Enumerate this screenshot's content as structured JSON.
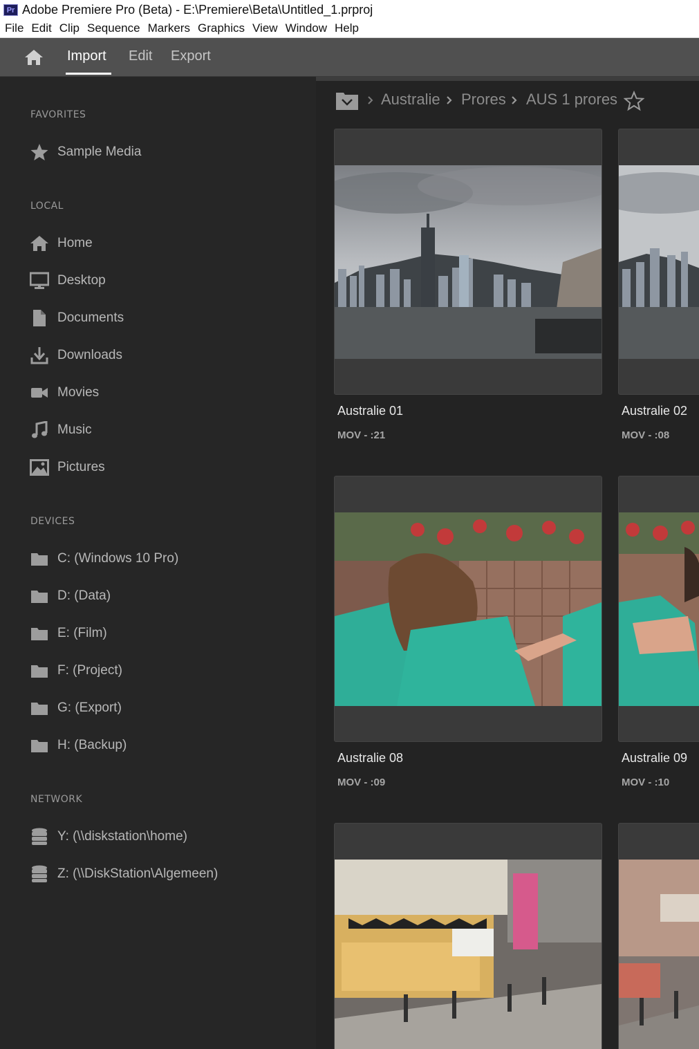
{
  "window": {
    "title": "Adobe Premiere Pro (Beta) - E:\\Premiere\\Beta\\Untitled_1.prproj",
    "app_icon_text": "Pr"
  },
  "menubar": [
    "File",
    "Edit",
    "Clip",
    "Sequence",
    "Markers",
    "Graphics",
    "View",
    "Window",
    "Help"
  ],
  "header": {
    "tabs": [
      {
        "label": "Import",
        "active": true
      },
      {
        "label": "Edit",
        "active": false
      },
      {
        "label": "Export",
        "active": false
      }
    ]
  },
  "sidebar": {
    "favorites_title": "FAVORITES",
    "favorites": [
      {
        "label": "Sample Media",
        "icon": "star-icon"
      }
    ],
    "local_title": "LOCAL",
    "local": [
      {
        "label": "Home",
        "icon": "home-icon"
      },
      {
        "label": "Desktop",
        "icon": "monitor-icon"
      },
      {
        "label": "Documents",
        "icon": "document-icon"
      },
      {
        "label": "Downloads",
        "icon": "download-icon"
      },
      {
        "label": "Movies",
        "icon": "video-camera-icon"
      },
      {
        "label": "Music",
        "icon": "music-note-icon"
      },
      {
        "label": "Pictures",
        "icon": "picture-icon"
      }
    ],
    "devices_title": "DEVICES",
    "devices": [
      {
        "label": "C: (Windows 10 Pro)",
        "icon": "folder-icon"
      },
      {
        "label": "D: (Data)",
        "icon": "folder-icon"
      },
      {
        "label": "E: (Film)",
        "icon": "folder-icon"
      },
      {
        "label": "F: (Project)",
        "icon": "folder-icon"
      },
      {
        "label": "G: (Export)",
        "icon": "folder-icon"
      },
      {
        "label": "H: (Backup)",
        "icon": "folder-icon"
      }
    ],
    "network_title": "NETWORK",
    "network": [
      {
        "label": "Y: (\\\\diskstation\\home)",
        "icon": "server-icon"
      },
      {
        "label": "Z: (\\\\DiskStation\\Algemeen)",
        "icon": "server-icon"
      }
    ]
  },
  "breadcrumb": {
    "items": [
      "Australie",
      "Prores",
      "AUS 1 prores"
    ]
  },
  "media": [
    {
      "name": "Australie 01",
      "meta": "MOV - :21"
    },
    {
      "name": "Australie 02",
      "meta": "MOV - :08"
    },
    {
      "name": "Australie 08",
      "meta": "MOV - :09"
    },
    {
      "name": "Australie 09",
      "meta": "MOV - :10"
    },
    {
      "name": "",
      "meta": ""
    },
    {
      "name": "",
      "meta": ""
    }
  ],
  "colors": {
    "sidebar_bg": "#262626",
    "header_bg": "#505050",
    "content_bg": "#232323",
    "tile_bg": "#3a3a3a",
    "accent_white": "#ffffff"
  }
}
